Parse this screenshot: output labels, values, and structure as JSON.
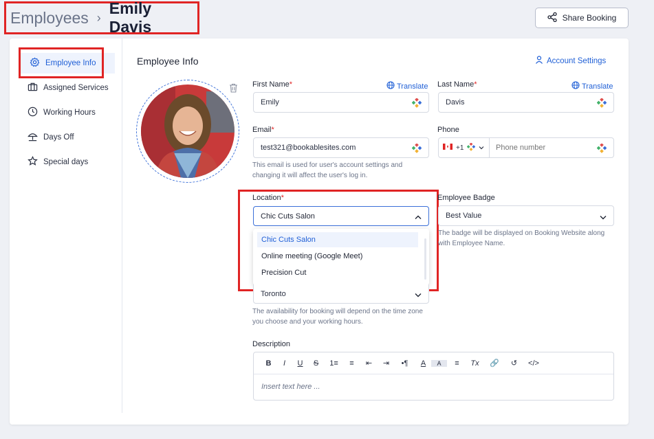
{
  "breadcrumb": {
    "parent": "Employees",
    "separator": "›",
    "current": "Emily Davis"
  },
  "header": {
    "share_label": "Share Booking"
  },
  "sidebar": {
    "items": [
      {
        "label": "Employee Info",
        "icon": "gear-icon"
      },
      {
        "label": "Assigned Services",
        "icon": "briefcase-icon"
      },
      {
        "label": "Working Hours",
        "icon": "clock-icon"
      },
      {
        "label": "Days Off",
        "icon": "umbrella-icon"
      },
      {
        "label": "Special days",
        "icon": "star-icon"
      }
    ]
  },
  "main": {
    "title": "Employee Info",
    "account_settings": "Account Settings",
    "first_name": {
      "label": "First Name",
      "value": "Emily",
      "translate": "Translate"
    },
    "last_name": {
      "label": "Last Name",
      "value": "Davis",
      "translate": "Translate"
    },
    "email": {
      "label": "Email",
      "value": "test321@bookablesites.com",
      "help": "This email is used for user's account settings and changing it will affect the user's log in."
    },
    "phone": {
      "label": "Phone",
      "code": "+1",
      "placeholder": "Phone number"
    },
    "location": {
      "label": "Location",
      "value": "Chic Cuts Salon",
      "options": [
        "Chic Cuts Salon",
        "Online meeting (Google Meet)",
        "Precision Cut"
      ]
    },
    "badge": {
      "label": "Employee Badge",
      "value": "Best Value",
      "help": "The badge will be displayed on Booking Website along with Employee Name."
    },
    "timezone": {
      "value": "Toronto",
      "help": "The availability for booking will depend on the time zone you choose and your working hours."
    },
    "description": {
      "label": "Description",
      "placeholder": "Insert text here ...",
      "toolbar": [
        "B",
        "I",
        "U",
        "S",
        "1≡",
        "≡",
        "⇤",
        "⇥",
        "•¶",
        "A",
        "A",
        "≡",
        "Tx",
        "🔗",
        "↺",
        "</>"
      ]
    }
  },
  "colors": {
    "accent": "#1f5fd6",
    "highlight": "#e02424"
  }
}
